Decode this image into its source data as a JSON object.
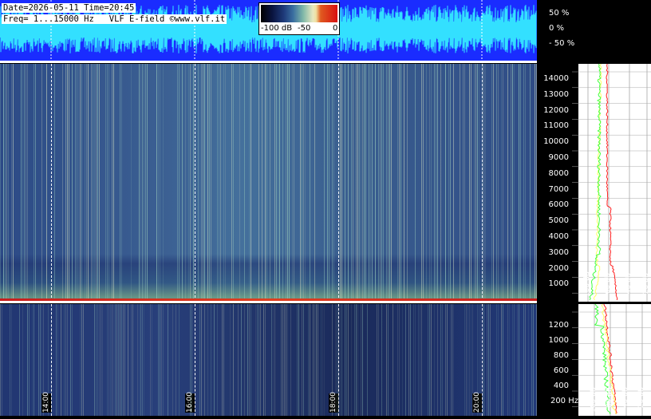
{
  "info": {
    "line1": "Date=2026-05-11 Time=20:45",
    "line2": "Freq= 1...15000 Hz   VLF E-field ©www.vlf.it"
  },
  "scale": {
    "labels": [
      "-100 dB",
      "-50",
      "0"
    ]
  },
  "waveform_axis": {
    "labels": [
      "50 %",
      "0 %",
      "- 50 %"
    ]
  },
  "time_axis": {
    "labels": [
      "14:00",
      "16:00",
      "18:00",
      "20:00"
    ]
  },
  "upper_freq_axis": {
    "labels": [
      "14000",
      "13000",
      "12000",
      "11000",
      "10000",
      "9000",
      "8000",
      "7000",
      "6000",
      "5000",
      "4000",
      "3000",
      "2000",
      "1000"
    ]
  },
  "upper_db_axis": {
    "labels": [
      "-100 dB",
      "-60 dB",
      "-40 dB",
      "-20 dB"
    ]
  },
  "lower_freq_axis": {
    "labels": [
      "1200",
      "1000",
      "800",
      "600",
      "400",
      "200 Hz"
    ]
  },
  "lower_db_axis": {
    "labels": [
      "-100 dB",
      "-60 dB",
      "-40 dB",
      "-20 dB"
    ]
  },
  "colors": {
    "waveform_bg": "#1a2cff",
    "waveform_trace": "#33e0ff",
    "spectrum_avg": "#ffff66",
    "spectrum_max": "#ff2020",
    "spectrum_min": "#40ff40"
  }
}
